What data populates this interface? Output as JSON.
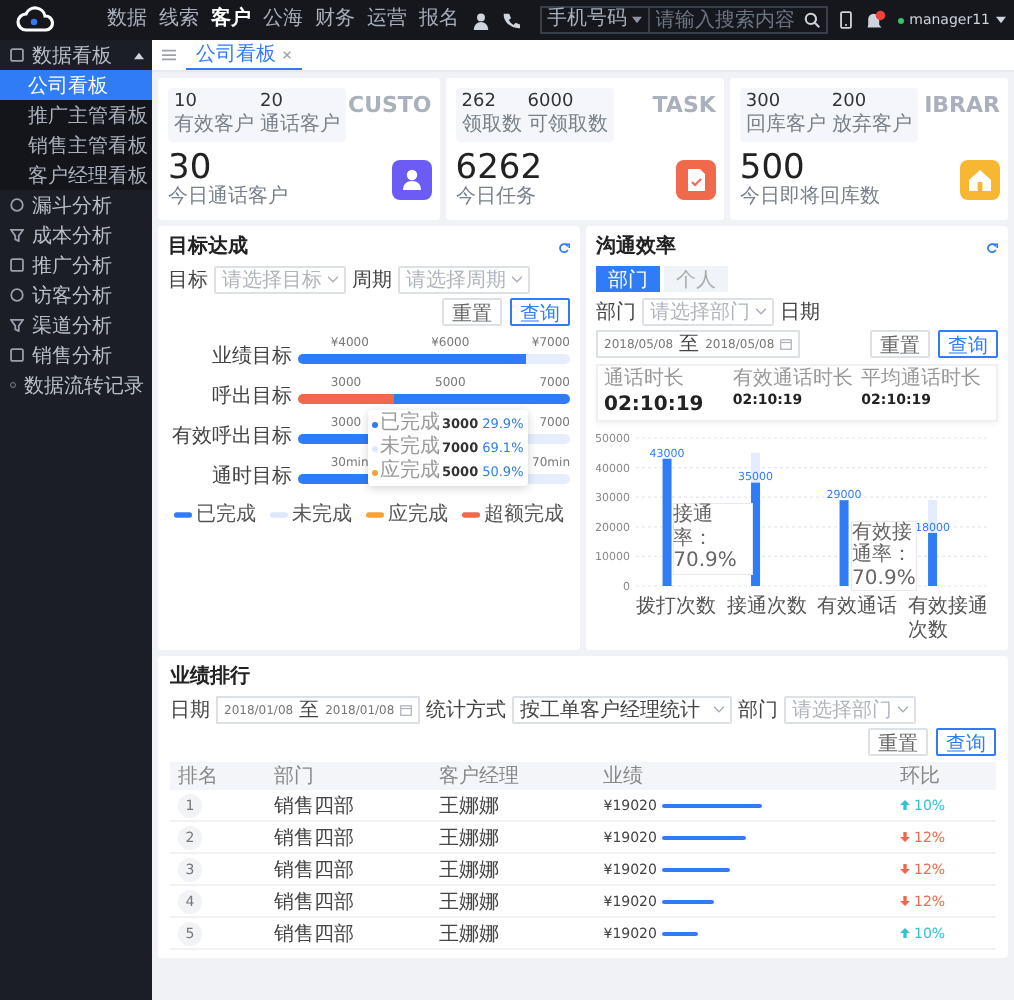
{
  "top_nav": [
    {
      "label": "数据",
      "selected": false
    },
    {
      "label": "线索",
      "selected": false
    },
    {
      "label": "客户",
      "selected": true
    },
    {
      "label": "公海",
      "selected": false
    },
    {
      "label": "财务",
      "selected": false
    },
    {
      "label": "运营",
      "selected": false
    },
    {
      "label": "报名",
      "selected": false
    }
  ],
  "search": {
    "scope": "手机号码",
    "placeholder": "请输入搜索内容"
  },
  "user": {
    "name": "manager11"
  },
  "sidebar": [
    {
      "label": "数据看板",
      "selected": false,
      "expanded": true,
      "children": [
        {
          "label": "公司看板",
          "selected": true
        },
        {
          "label": "推广主管看板",
          "selected": false
        },
        {
          "label": "销售主管看板",
          "selected": false
        },
        {
          "label": "客户经理看板",
          "selected": false
        }
      ]
    },
    {
      "label": "漏斗分析",
      "selected": false
    },
    {
      "label": "成本分析",
      "selected": false
    },
    {
      "label": "推广分析",
      "selected": false
    },
    {
      "label": "访客分析",
      "selected": false
    },
    {
      "label": "渠道分析",
      "selected": false
    },
    {
      "label": "销售分析",
      "selected": false
    },
    {
      "label": "数据流转记录",
      "selected": false
    }
  ],
  "tabs": [
    {
      "label": "公司看板",
      "selected": true
    }
  ],
  "stat_cards": [
    {
      "backdrop": "CUSTO",
      "kind": "person",
      "color": "#6b5cf6",
      "metrics": [
        {
          "value": "10",
          "label": "有效客户"
        },
        {
          "value": "20",
          "label": "通话客户"
        }
      ],
      "total": {
        "value": "30",
        "label": "今日通话客户"
      }
    },
    {
      "backdrop": "TASK",
      "kind": "task",
      "color": "#f0694a",
      "metrics": [
        {
          "value": "262",
          "label": "领取数"
        },
        {
          "value": "6000",
          "label": "可领取数"
        }
      ],
      "total": {
        "value": "6262",
        "label": "今日任务"
      }
    },
    {
      "backdrop": "IBRAR",
      "kind": "home",
      "color": "#f7b733",
      "metrics": [
        {
          "value": "300",
          "label": "回库客户"
        },
        {
          "value": "200",
          "label": "放弃客户"
        }
      ],
      "total": {
        "value": "500",
        "label": "今日即将回库数"
      }
    }
  ],
  "goal_panel": {
    "title": "目标达成",
    "filters": [
      {
        "label": "目标",
        "placeholder": "请选择目标"
      },
      {
        "label": "周期",
        "placeholder": "请选择周期"
      }
    ],
    "buttons": [
      {
        "label": "重置",
        "primary": false
      },
      {
        "label": "查询",
        "primary": true
      }
    ],
    "goals": [
      {
        "label": "业绩目标",
        "ticks": [
          "¥4000",
          "¥6000",
          "¥7000"
        ],
        "segments": [
          {
            "kind": "done",
            "level": 0.84
          }
        ]
      },
      {
        "label": "呼出目标",
        "ticks": [
          "3000",
          "5000",
          "7000"
        ],
        "segments": [
          {
            "kind": "over",
            "level": 0.35
          },
          {
            "kind": "done",
            "level": 0.65
          }
        ]
      },
      {
        "label": "有效呼出目标",
        "ticks": [
          "3000",
          "7000"
        ],
        "segments": [
          {
            "kind": "done",
            "level": 0.47
          }
        ]
      },
      {
        "label": "通时目标",
        "ticks": [
          "30min",
          "70min"
        ],
        "segments": [
          {
            "kind": "done",
            "level": 0.35
          }
        ]
      }
    ],
    "tooltip": [
      {
        "kind": "done",
        "label": "已完成",
        "value": "3000",
        "percent": "29.9%"
      },
      {
        "kind": "todo",
        "label": "未完成",
        "value": "7000",
        "percent": "69.1%"
      },
      {
        "kind": "due",
        "label": "应完成",
        "value": "5000",
        "percent": "50.9%"
      }
    ],
    "legend": [
      {
        "kind": "done",
        "label": "已完成"
      },
      {
        "kind": "todo",
        "label": "未完成"
      },
      {
        "kind": "due",
        "label": "应完成"
      },
      {
        "kind": "over",
        "label": "超额完成"
      }
    ]
  },
  "comm_panel": {
    "title": "沟通效率",
    "modes": [
      {
        "label": "部门",
        "selected": true
      },
      {
        "label": "个人",
        "selected": false
      }
    ],
    "department": {
      "label": "部门",
      "placeholder": "请选择部门"
    },
    "date": {
      "label": "日期",
      "from": "2018/05/08",
      "sep": "至",
      "to": "2018/05/08"
    },
    "buttons": [
      {
        "label": "重置",
        "primary": false
      },
      {
        "label": "查询",
        "primary": true
      }
    ],
    "stats": [
      {
        "kind": "main",
        "label": "通话时长",
        "value": "02:10:19"
      },
      {
        "kind": "sub",
        "label": "有效通话时长",
        "value": "02:10:19"
      },
      {
        "kind": "sub",
        "label": "平均通话时长",
        "value": "02:10:19"
      }
    ],
    "chart_data": {
      "type": "bar",
      "categories": [
        "拨打次数",
        "接通次数",
        "有效通话",
        "有效接通次数"
      ],
      "stacked": true,
      "grid": true,
      "series": [
        {
          "color": "#2f7cf6",
          "values": [
            43000,
            35000,
            29000,
            18000
          ],
          "value_labels": [
            "43000",
            "35000",
            "29000",
            "18000"
          ]
        },
        {
          "color": "#e3edff",
          "values": [
            null,
            10000,
            null,
            11000
          ]
        }
      ],
      "ylim": [
        0,
        50000
      ],
      "yticks": [
        0,
        10000,
        20000,
        30000,
        40000,
        50000
      ],
      "annotations": [
        {
          "text": "接通率：70.9%"
        },
        {
          "text": "有效接通率：70.9%"
        }
      ]
    }
  },
  "ranking": {
    "title": "业绩排行",
    "date": {
      "label": "日期",
      "from": "2018/01/08",
      "sep": "至",
      "to": "2018/01/08"
    },
    "method": {
      "label": "统计方式",
      "value": "按工单客户经理统计"
    },
    "department": {
      "label": "部门",
      "placeholder": "请选择部门"
    },
    "buttons": [
      {
        "label": "重置",
        "primary": false
      },
      {
        "label": "查询",
        "primary": true
      }
    ],
    "columns": [
      "排名",
      "部门",
      "客户经理",
      "业绩",
      "环比"
    ],
    "rows": [
      {
        "rank": "1",
        "department": "销售四部",
        "manager": "王娜娜",
        "amount": "¥19020",
        "kind": "up",
        "change": "10%"
      },
      {
        "rank": "2",
        "department": "销售四部",
        "manager": "王娜娜",
        "amount": "¥19020",
        "kind": "down",
        "change": "12%"
      },
      {
        "rank": "3",
        "department": "销售四部",
        "manager": "王娜娜",
        "amount": "¥19020",
        "kind": "down",
        "change": "12%"
      },
      {
        "rank": "4",
        "department": "销售四部",
        "manager": "王娜娜",
        "amount": "¥19020",
        "kind": "down",
        "change": "12%"
      },
      {
        "rank": "5",
        "department": "销售四部",
        "manager": "王娜娜",
        "amount": "¥19020",
        "kind": "up",
        "change": "10%"
      }
    ]
  }
}
